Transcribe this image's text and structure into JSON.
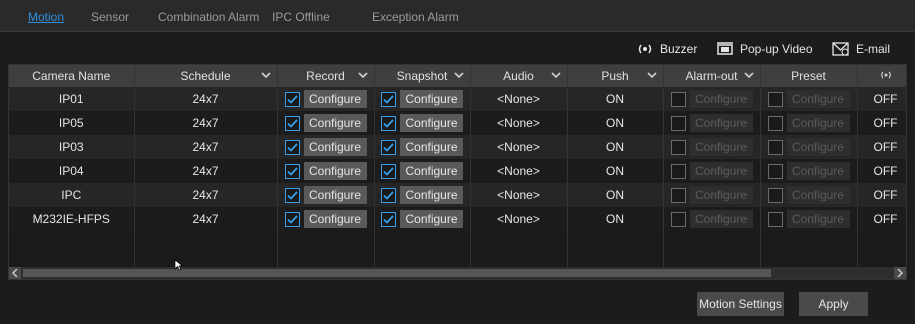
{
  "tabs": [
    "Motion",
    "Sensor",
    "Combination Alarm",
    "IPC Offline",
    "Exception Alarm"
  ],
  "toolbar": {
    "buzzer": "Buzzer",
    "popup_video": "Pop-up Video",
    "email": "E-mail"
  },
  "columns": {
    "camera_name": "Camera Name",
    "schedule": "Schedule",
    "record": "Record",
    "snapshot": "Snapshot",
    "audio": "Audio",
    "push": "Push",
    "alarm_out": "Alarm-out",
    "preset": "Preset"
  },
  "configure_label": "Configure",
  "rows": [
    {
      "name": "IP01",
      "schedule": "24x7",
      "audio": "<None>",
      "push": "ON",
      "buzzer": "OFF",
      "record": true,
      "snapshot": true,
      "alarm_out": false,
      "preset": false
    },
    {
      "name": "IP05",
      "schedule": "24x7",
      "audio": "<None>",
      "push": "ON",
      "buzzer": "OFF",
      "record": true,
      "snapshot": true,
      "alarm_out": false,
      "preset": false
    },
    {
      "name": "IP03",
      "schedule": "24x7",
      "audio": "<None>",
      "push": "ON",
      "buzzer": "OFF",
      "record": true,
      "snapshot": true,
      "alarm_out": false,
      "preset": false
    },
    {
      "name": "IP04",
      "schedule": "24x7",
      "audio": "<None>",
      "push": "ON",
      "buzzer": "OFF",
      "record": true,
      "snapshot": true,
      "alarm_out": false,
      "preset": false
    },
    {
      "name": "IPC",
      "schedule": "24x7",
      "audio": "<None>",
      "push": "ON",
      "buzzer": "OFF",
      "record": true,
      "snapshot": true,
      "alarm_out": false,
      "preset": false
    },
    {
      "name": "M232IE-HFPS",
      "schedule": "24x7",
      "audio": "<None>",
      "push": "ON",
      "buzzer": "OFF",
      "record": true,
      "snapshot": true,
      "alarm_out": false,
      "preset": false
    }
  ],
  "buttons": {
    "motion_settings": "Motion Settings",
    "apply": "Apply"
  },
  "colors": {
    "accent": "#2f8fe0",
    "checkbox_on": "#3a9fe8"
  }
}
